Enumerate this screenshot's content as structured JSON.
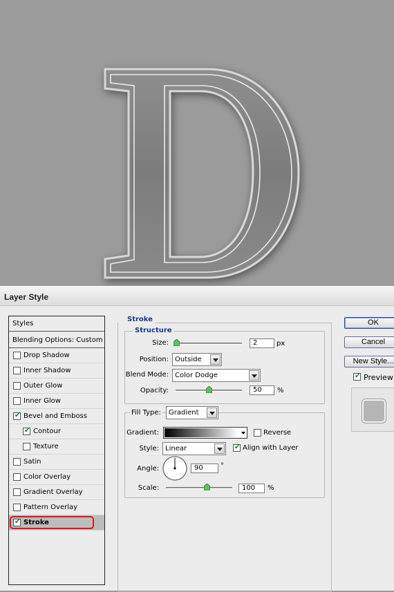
{
  "dialog": {
    "title": "Layer Style"
  },
  "styles_panel": {
    "header": "Styles",
    "blending": "Blending Options: Custom",
    "items": [
      {
        "label": "Drop Shadow",
        "checked": false
      },
      {
        "label": "Inner Shadow",
        "checked": false
      },
      {
        "label": "Outer Glow",
        "checked": false
      },
      {
        "label": "Inner Glow",
        "checked": false
      },
      {
        "label": "Bevel and Emboss",
        "checked": true
      },
      {
        "label": "Contour",
        "checked": true
      },
      {
        "label": "Texture",
        "checked": false
      },
      {
        "label": "Satin",
        "checked": false
      },
      {
        "label": "Color Overlay",
        "checked": false
      },
      {
        "label": "Gradient Overlay",
        "checked": false
      },
      {
        "label": "Pattern Overlay",
        "checked": false
      },
      {
        "label": "Stroke",
        "checked": true,
        "selected": true
      }
    ]
  },
  "stroke": {
    "title": "Stroke",
    "structure": {
      "title": "Structure",
      "size_label": "Size:",
      "size_value": "2",
      "size_unit": "px",
      "position_label": "Position:",
      "position_value": "Outside",
      "blend_label": "Blend Mode:",
      "blend_value": "Color Dodge",
      "opacity_label": "Opacity:",
      "opacity_value": "50",
      "opacity_unit": "%"
    },
    "fill": {
      "filltype_label": "Fill Type:",
      "filltype_value": "Gradient",
      "gradient_label": "Gradient:",
      "reverse_label": "Reverse",
      "reverse_checked": false,
      "style_label": "Style:",
      "style_value": "Linear",
      "align_label": "Align with Layer",
      "align_checked": true,
      "angle_label": "Angle:",
      "angle_value": "90",
      "angle_unit": "°",
      "scale_label": "Scale:",
      "scale_value": "100",
      "scale_unit": "%"
    }
  },
  "buttons": {
    "ok": "OK",
    "cancel": "Cancel",
    "new_style": "New Style...",
    "preview_label": "Preview",
    "preview_checked": true
  },
  "icons": {
    "checkbox": "checkmark-icon",
    "dropdown": "chevron-down-icon"
  },
  "colors": {
    "accent_title": "#1b3a8a",
    "highlight_ring": "#d51921",
    "check": "#157d1b"
  }
}
